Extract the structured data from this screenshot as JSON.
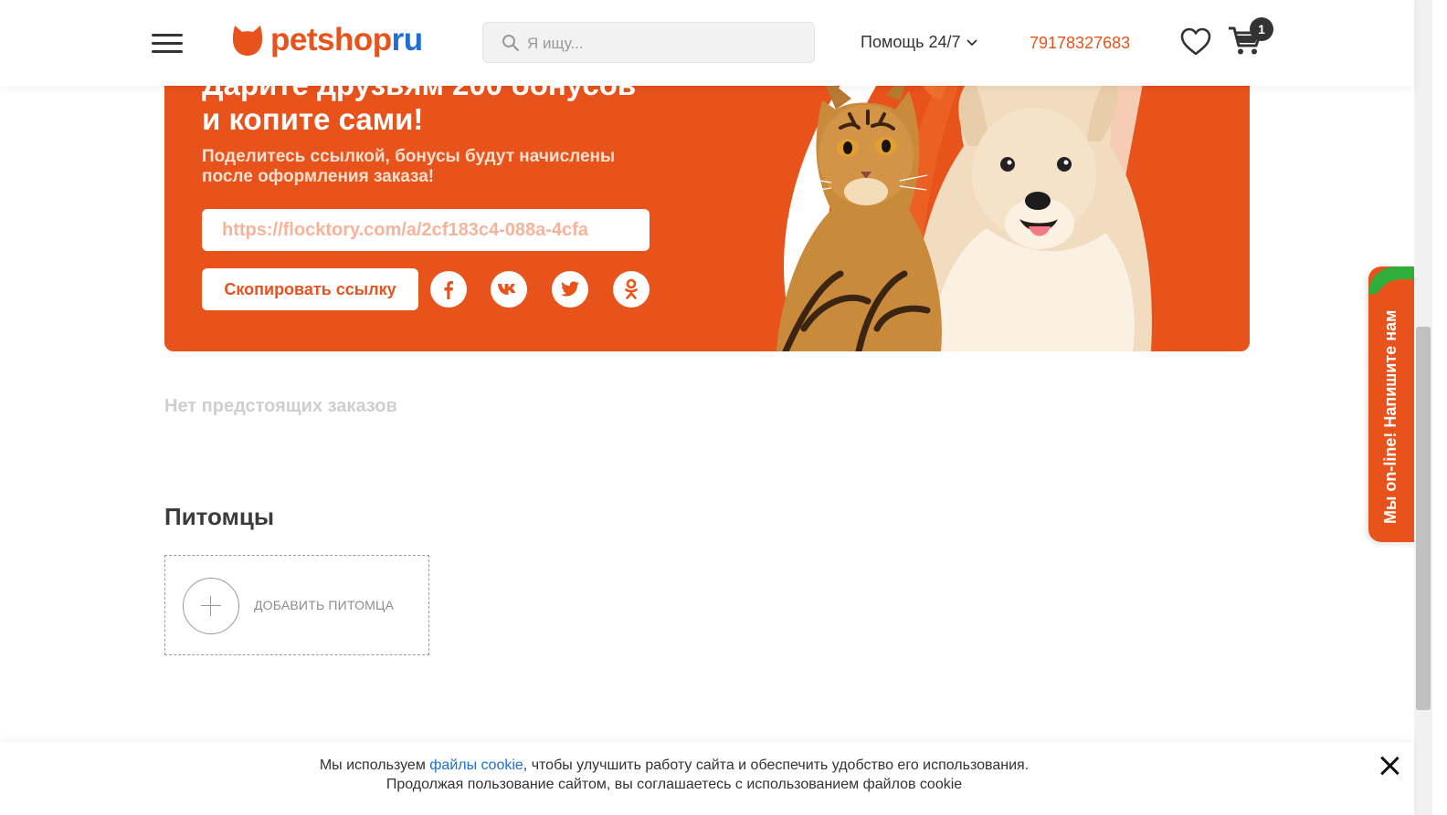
{
  "header": {
    "logo_part1": "petshop",
    "logo_part2": "ru",
    "search_placeholder": "Я ищу...",
    "help_label": "Помощь 24/7",
    "phone": "79178327683",
    "cart_count": "1"
  },
  "banner": {
    "title_line1": "Дарите друзьям 200 бонусов",
    "title_line2": "и копите сами!",
    "subtitle_line1": "Поделитесь ссылкой, бонусы будут начислены",
    "subtitle_line2": "после оформления заказа!",
    "referral_link": "https://flocktory.com/a/2cf183c4-088a-4cfa",
    "copy_button": "Скопировать ссылку",
    "social_icons": [
      "facebook-icon",
      "vk-icon",
      "twitter-icon",
      "odnoklassniki-icon"
    ]
  },
  "orders": {
    "empty_text": "Нет предстоящих заказов"
  },
  "pets": {
    "title": "Питомцы",
    "add_label": "ДОБАВИТЬ ПИТОМЦА"
  },
  "chat": {
    "label": "Мы on-line! Напишите нам"
  },
  "cookie": {
    "text_before": "Мы используем ",
    "link": "файлы cookie",
    "text_after": ", чтобы улучшить работу сайта и обеспечить удобство его использования.",
    "line2": "Продолжая пользование сайтом, вы соглашаетесь с использованием файлов cookie"
  },
  "colors": {
    "brand_orange": "#e8521b",
    "brand_blue": "#1e6fcf",
    "chat_green": "#2fae3a"
  }
}
